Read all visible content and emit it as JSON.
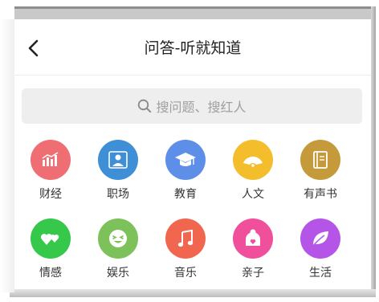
{
  "header": {
    "title": "问答-听就知道",
    "back_icon": "chevron-left-icon"
  },
  "search": {
    "placeholder": "搜问题、搜红人",
    "icon": "search-icon"
  },
  "categories": [
    {
      "label": "财经",
      "icon": "bar-chart-icon",
      "color": "#ee6e73"
    },
    {
      "label": "职场",
      "icon": "person-icon",
      "color": "#3e8fd5"
    },
    {
      "label": "教育",
      "icon": "graduation-cap-icon",
      "color": "#5d8ee8"
    },
    {
      "label": "人文",
      "icon": "folding-fan-icon",
      "color": "#f4bd2b"
    },
    {
      "label": "有声书",
      "icon": "book-icon",
      "color": "#c49a3b"
    },
    {
      "label": "情感",
      "icon": "hearts-icon",
      "color": "#35c84a"
    },
    {
      "label": "娱乐",
      "icon": "smiley-icon",
      "color": "#7dc15a"
    },
    {
      "label": "音乐",
      "icon": "music-note-icon",
      "color": "#f1664f"
    },
    {
      "label": "亲子",
      "icon": "parent-child-icon",
      "color": "#ef4f9b"
    },
    {
      "label": "生活",
      "icon": "leaf-icon",
      "color": "#b455e8"
    }
  ]
}
